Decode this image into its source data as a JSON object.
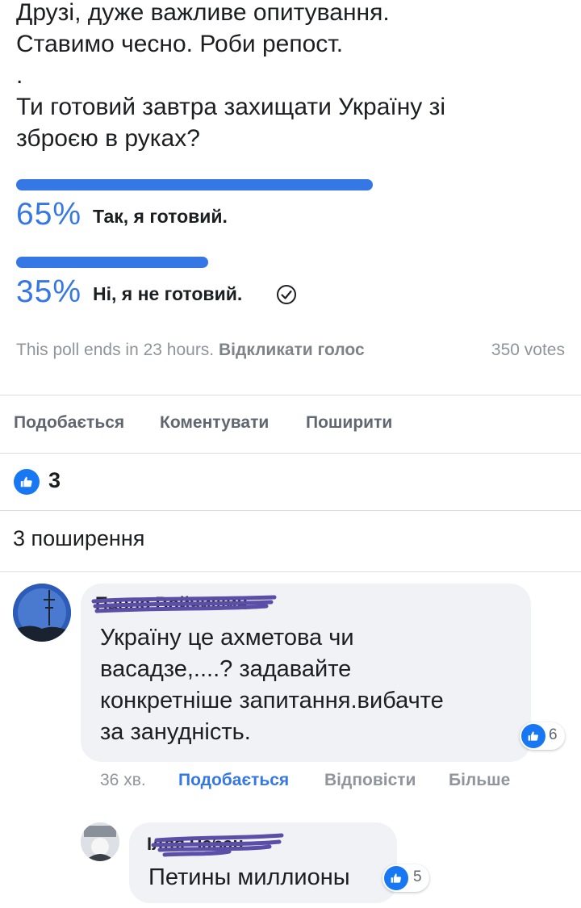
{
  "post": {
    "lines": [
      "Друзі, дуже важливе опитування.",
      "Ставимо чесно. Роби репост.",
      ".",
      "Ти готовий завтра захищати Україну зі",
      "зброєю в руках?"
    ]
  },
  "poll": {
    "options": [
      {
        "percent": "65%",
        "label": "Так, я готовий.",
        "share": 0.65,
        "selected": false
      },
      {
        "percent": "35%",
        "label": "Ні, я не готовий.",
        "share": 0.35,
        "selected": true
      }
    ],
    "ends_text": "This poll ends in 23 hours.",
    "retract_label": "Відкликати голос",
    "votes": "350 votes"
  },
  "actions": {
    "like": "Подобається",
    "comment": "Коментувати",
    "share": "Поширити"
  },
  "reactions": {
    "count": "3",
    "icon": "thumbs-up-icon"
  },
  "shares_text": "3 поширення",
  "comments": [
    {
      "author": "Павло Войчишин",
      "text_lines": [
        "Україну це ахметова чи",
        "васадзе,....? задавайте",
        "конкретніше запитання.вибачте",
        "за занудність."
      ],
      "reactions": "6",
      "time": "36 хв.",
      "like_label": "Подобається",
      "reply_label": "Відповісти",
      "more_label": "Більше"
    },
    {
      "author": "Ілля Чабан",
      "text_lines": [
        "Петины миллионы"
      ],
      "reactions": "5"
    }
  ],
  "colors": {
    "accent": "#3578e5",
    "like_blue": "#1877f2",
    "bubble": "#f0f2f5",
    "redaction": "#5a4ea8"
  }
}
